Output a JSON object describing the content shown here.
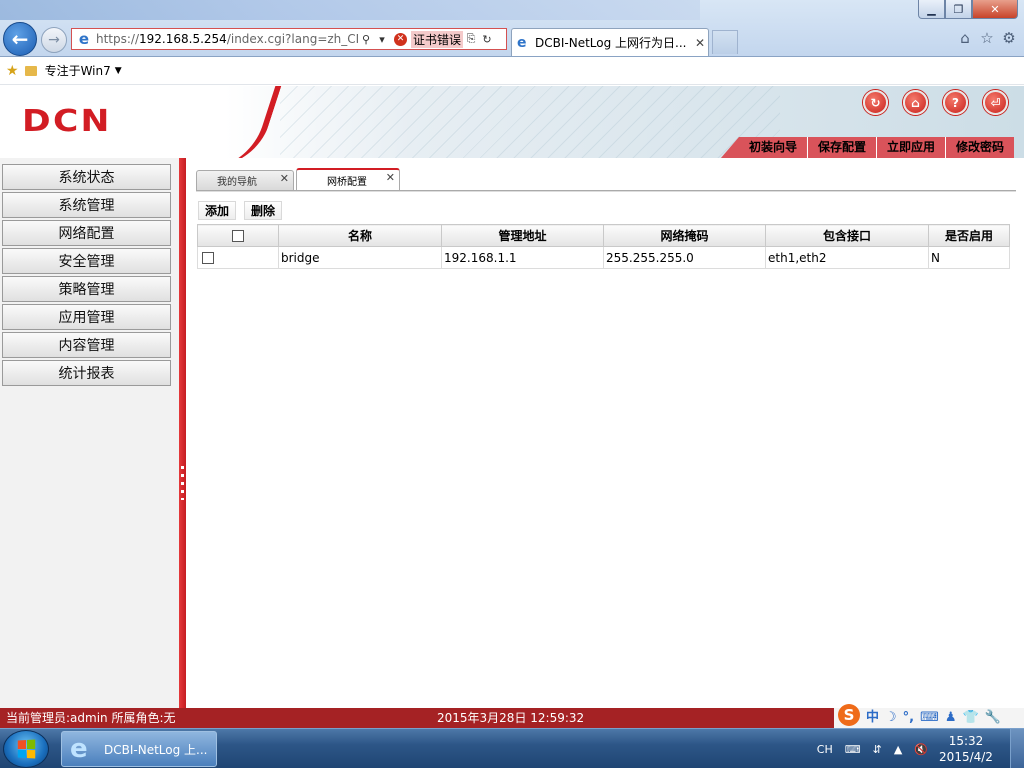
{
  "browser": {
    "address_url_prefix": "https://",
    "address_host": "192.168.5.254",
    "address_path": "/index.cgi?lang=zh_CN.U",
    "cert_error": "证书错误",
    "tab_title": "DCBI-NetLog 上网行为日...",
    "favorites": {
      "folder_label": "专注于Win7"
    }
  },
  "header": {
    "logo": "DCN",
    "menu": [
      "初装向导",
      "保存配置",
      "立即应用",
      "修改密码"
    ]
  },
  "sidebar": {
    "items": [
      "系统状态",
      "系统管理",
      "网络配置",
      "安全管理",
      "策略管理",
      "应用管理",
      "内容管理",
      "统计报表"
    ]
  },
  "content": {
    "tabs": [
      {
        "label": "我的导航",
        "active": false
      },
      {
        "label": "网桥配置",
        "active": true
      }
    ],
    "toolbar": {
      "add_label": "添加",
      "delete_label": "删除"
    },
    "table": {
      "columns": [
        "名称",
        "管理地址",
        "网络掩码",
        "包含接口",
        "是否启用"
      ],
      "rows": [
        {
          "name": "bridge",
          "address": "192.168.1.1",
          "mask": "255.255.255.0",
          "interfaces": "eth1,eth2",
          "enabled": "N"
        }
      ]
    }
  },
  "status": {
    "user": "当前管理员:admin  所属角色:无",
    "time": "2015年3月28日 12:59:32",
    "ime_label": "中"
  },
  "taskbar": {
    "ie_task_label": "DCBI-NetLog 上...",
    "lang": "CH",
    "clock_time": "15:32",
    "clock_date": "2015/4/2"
  },
  "colors": {
    "accent": "#d21d24",
    "status_bar": "#a52224",
    "menu_bg": "#d9535a"
  }
}
